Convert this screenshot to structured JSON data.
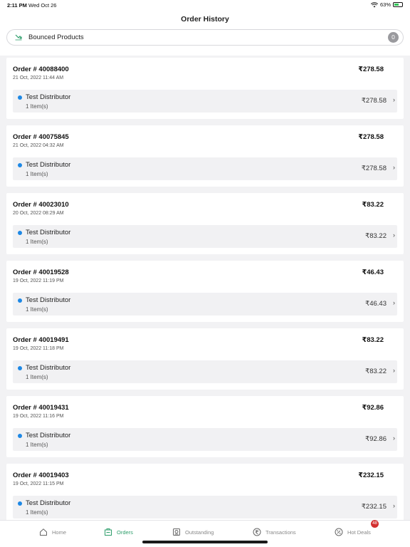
{
  "status": {
    "time": "2:11 PM",
    "date": "Wed Oct 26",
    "battery": "63%",
    "battery_level": 0.63
  },
  "header": {
    "title": "Order History"
  },
  "bounced": {
    "label": "Bounced Products",
    "count": "0"
  },
  "orders": [
    {
      "id": "Order # 40088400",
      "date": "21 Oct, 2022 11:44 AM",
      "total": "₹278.58",
      "distributor": "Test Distributor",
      "items": "1 Item(s)",
      "amount": "₹278.58"
    },
    {
      "id": "Order # 40075845",
      "date": "21 Oct, 2022 04:32 AM",
      "total": "₹278.58",
      "distributor": "Test Distributor",
      "items": "1 Item(s)",
      "amount": "₹278.58"
    },
    {
      "id": "Order # 40023010",
      "date": "20 Oct, 2022 08:29 AM",
      "total": "₹83.22",
      "distributor": "Test Distributor",
      "items": "1 Item(s)",
      "amount": "₹83.22"
    },
    {
      "id": "Order # 40019528",
      "date": "19 Oct, 2022 11:19 PM",
      "total": "₹46.43",
      "distributor": "Test Distributor",
      "items": "1 Item(s)",
      "amount": "₹46.43"
    },
    {
      "id": "Order # 40019491",
      "date": "19 Oct, 2022 11:18 PM",
      "total": "₹83.22",
      "distributor": "Test Distributor",
      "items": "1 Item(s)",
      "amount": "₹83.22"
    },
    {
      "id": "Order # 40019431",
      "date": "19 Oct, 2022 11:16 PM",
      "total": "₹92.86",
      "distributor": "Test Distributor",
      "items": "1 Item(s)",
      "amount": "₹92.86"
    },
    {
      "id": "Order # 40019403",
      "date": "19 Oct, 2022 11:15 PM",
      "total": "₹232.15",
      "distributor": "Test Distributor",
      "items": "1 Item(s)",
      "amount": "₹232.15"
    }
  ],
  "tabs": [
    {
      "label": "Home",
      "icon": "home-icon"
    },
    {
      "label": "Orders",
      "icon": "orders-icon",
      "active": true
    },
    {
      "label": "Outstanding",
      "icon": "outstanding-icon"
    },
    {
      "label": "Transactions",
      "icon": "rupee-icon"
    },
    {
      "label": "Hot Deals",
      "icon": "discount-icon",
      "badge": "48"
    }
  ],
  "colors": {
    "accent": "#2e9e6b",
    "dot": "#1e88e5",
    "badge": "#d32f2f"
  }
}
